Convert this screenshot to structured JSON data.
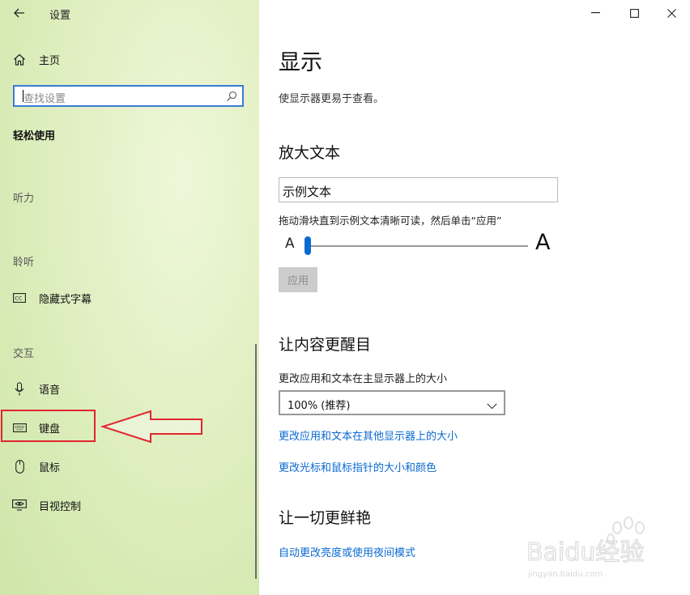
{
  "window": {
    "app_title": "设置",
    "controls": [
      "minimize",
      "maximize",
      "close"
    ]
  },
  "sidebar": {
    "home_label": "主页",
    "search_placeholder": "查找设置",
    "section_title": "轻松使用",
    "groups": {
      "hearing": "听力",
      "listening": "聆听",
      "interaction": "交互"
    },
    "items": {
      "captions": "隐藏式字幕",
      "speech": "语音",
      "keyboard": "键盘",
      "mouse": "鼠标",
      "eye_control": "目视控制"
    },
    "icons": [
      "back-arrow-icon",
      "home-icon",
      "search-icon",
      "captions-icon",
      "microphone-icon",
      "keyboard-icon",
      "mouse-icon",
      "eye-control-icon"
    ]
  },
  "main": {
    "title": "显示",
    "description": "使显示器更易于查看。",
    "enlarge_text": {
      "heading": "放大文本",
      "sample_text": "示例文本",
      "hint": "拖动滑块直到示例文本清晰可读，然后单击“应用”",
      "small_a": "A",
      "large_a": "A",
      "slider_value": 0,
      "apply_label": "应用"
    },
    "make_prominent": {
      "heading": "让内容更醒目",
      "size_label": "更改应用和文本在主显示器上的大小",
      "size_value": "100% (推荐)",
      "link_other_displays": "更改应用和文本在其他显示器上的大小",
      "link_cursor": "更改光标和鼠标指针的大小和颜色"
    },
    "brighter": {
      "heading": "让一切更鲜艳",
      "link_night_mode": "自动更改亮度或使用夜间模式"
    }
  },
  "annotation": {
    "highlight_color": "#e0262e",
    "target": "keyboard"
  },
  "watermark": {
    "text": "Baidu经验",
    "url": "jingyan.baidu.com"
  },
  "colors": {
    "accent": "#0a6ad2",
    "link": "#0a6ad2"
  }
}
